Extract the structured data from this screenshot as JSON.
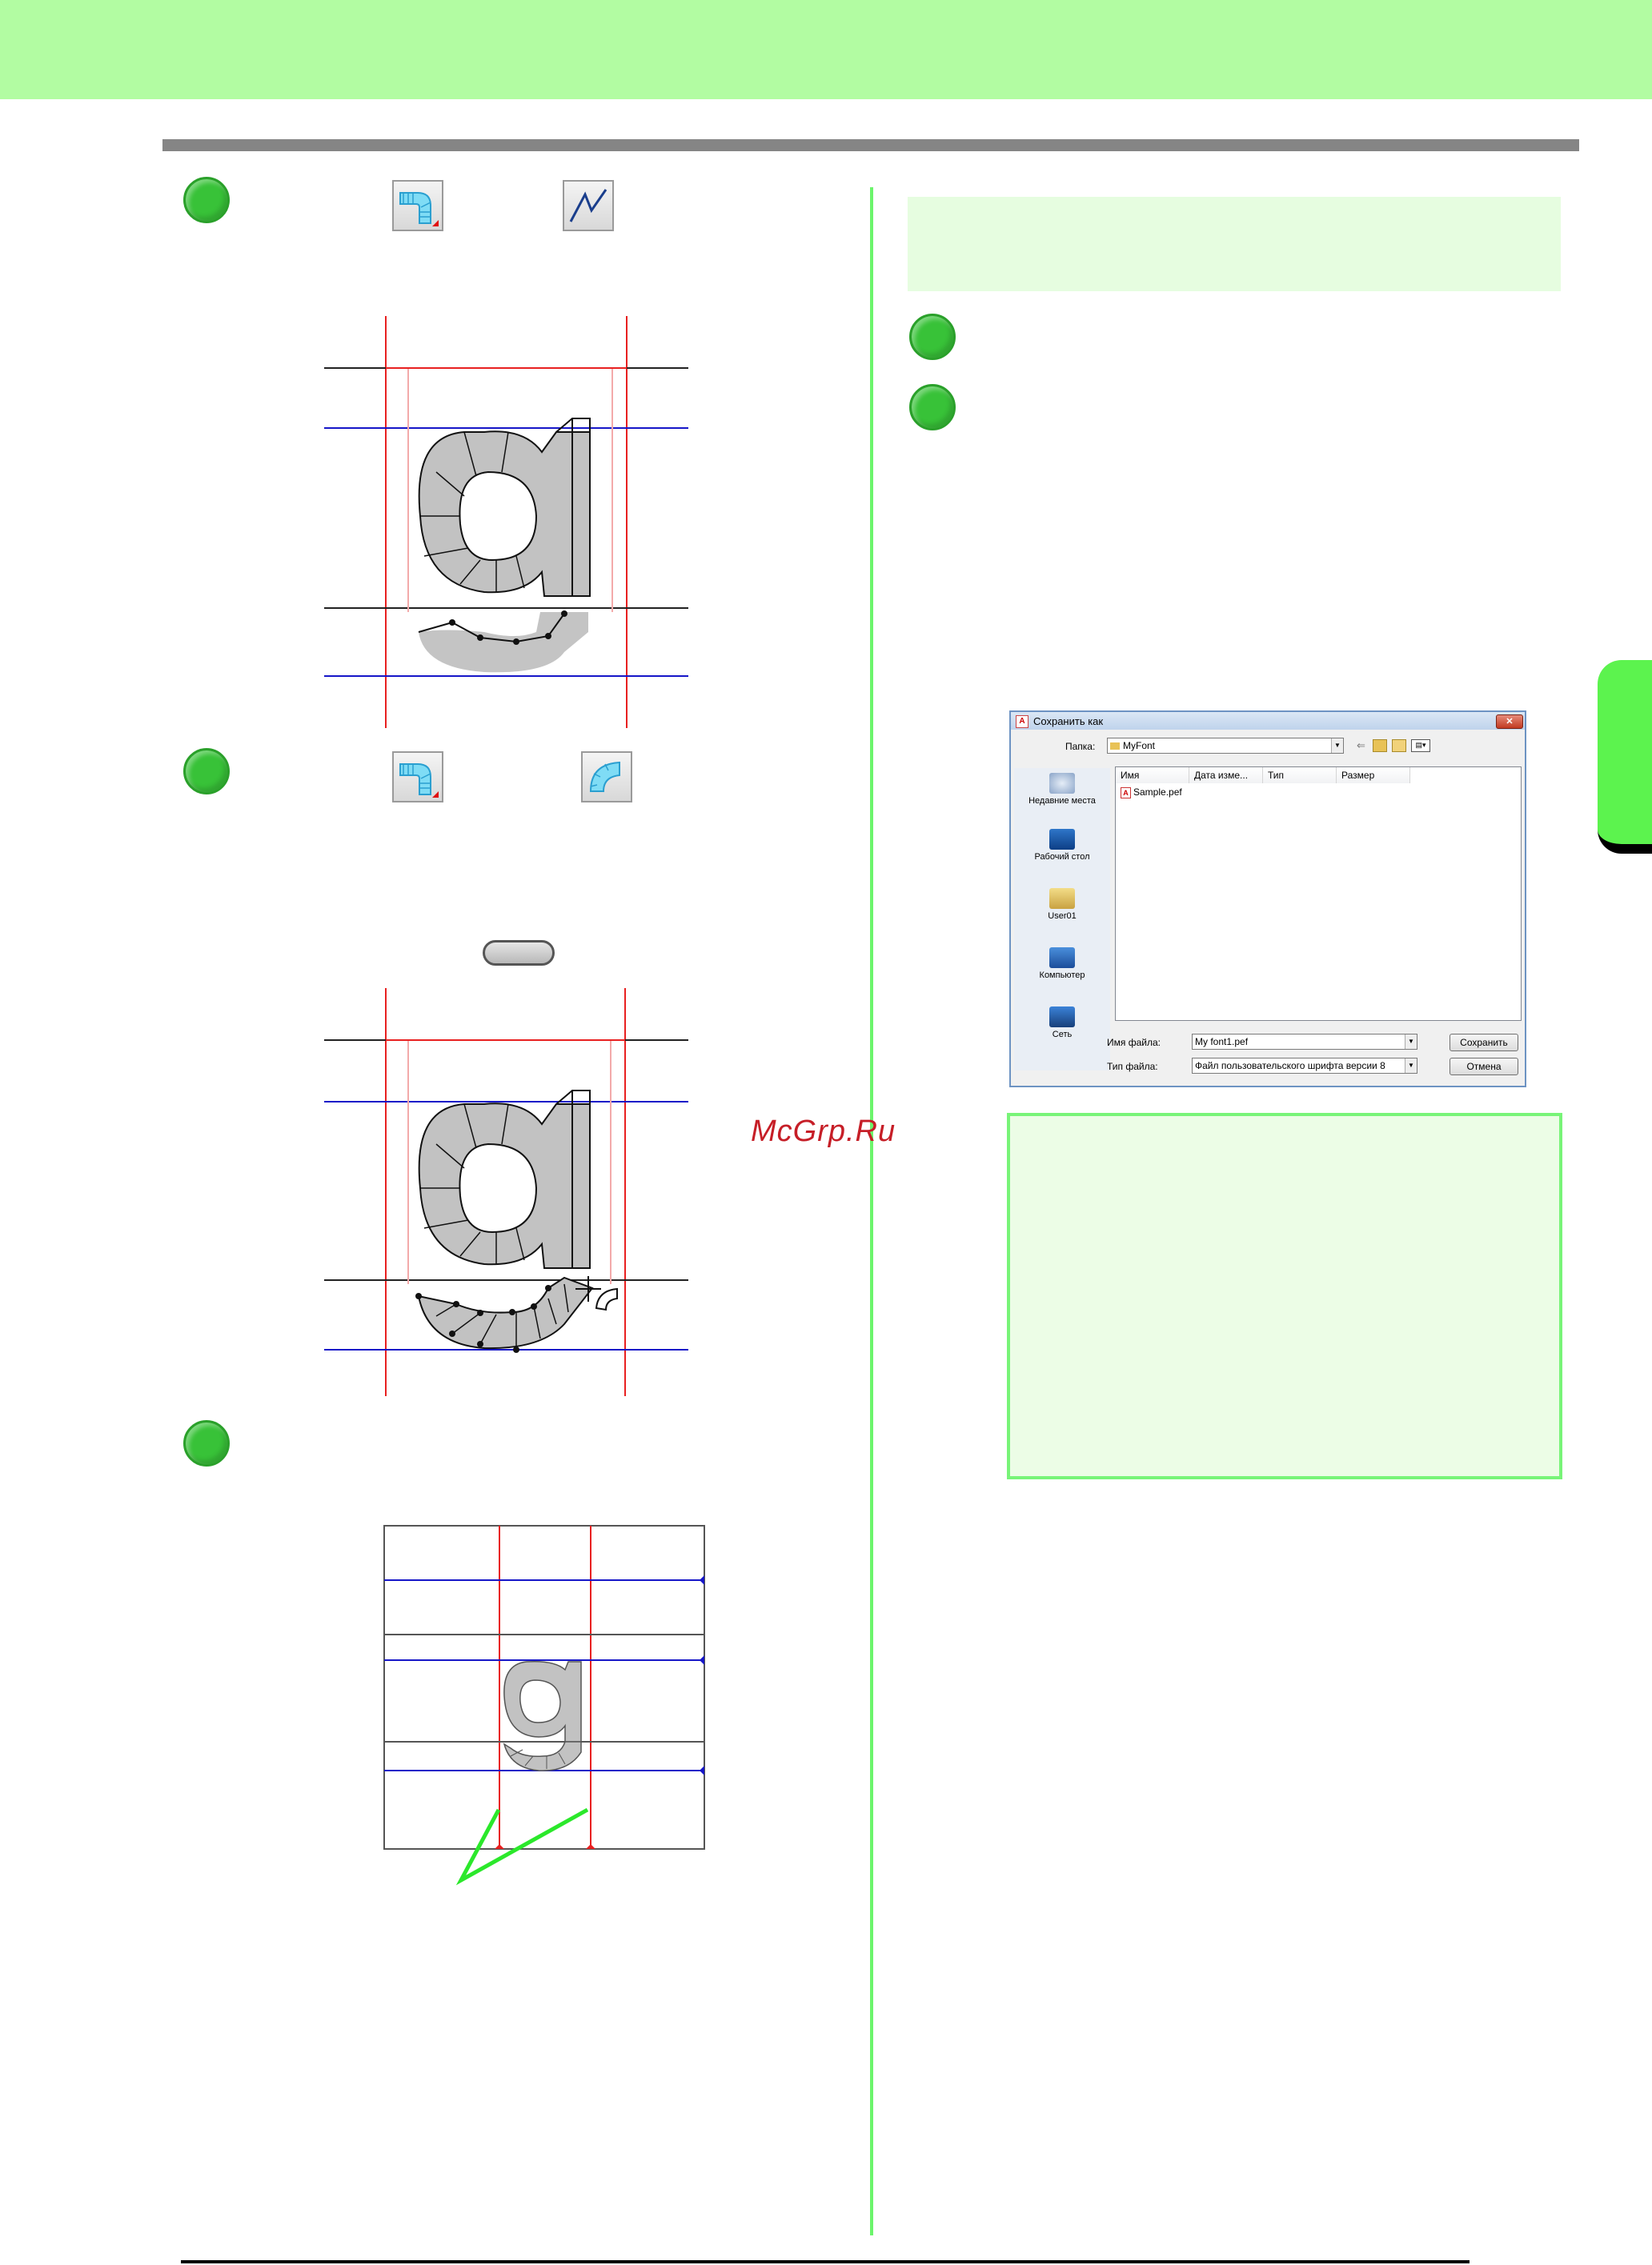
{
  "watermark": "McGrp.Ru",
  "colors": {
    "header_band": "#b2fca2",
    "step_dot": "#38c238",
    "divider": "#6cf56c",
    "guide_red": "#e82020",
    "guide_blue": "#1616c8",
    "glyph_fill": "#c2c2c2",
    "callout_green": "#2be82b"
  },
  "icons": {
    "step1_tool": "block-tool-icon",
    "step1_subtool": "line-segment-icon",
    "step2_tool": "block-tool-icon",
    "step2_subtool": "arc-block-icon"
  },
  "dialog": {
    "title": "Сохранить как",
    "folder_label": "Папка:",
    "folder_value": "MyFont",
    "columns": [
      "Имя",
      "Дата изме...",
      "Тип",
      "Размер"
    ],
    "files": [
      "Sample.pef"
    ],
    "places": [
      "Недавние места",
      "Рабочий стол",
      "User01",
      "Компьютер",
      "Сеть"
    ],
    "filename_label": "Имя файла:",
    "filename_value": "My font1.pef",
    "filetype_label": "Тип файла:",
    "filetype_value": "Файл пользовательского шрифта версии 8",
    "save_button": "Сохранить",
    "cancel_button": "Отмена",
    "app_icon": "A"
  }
}
